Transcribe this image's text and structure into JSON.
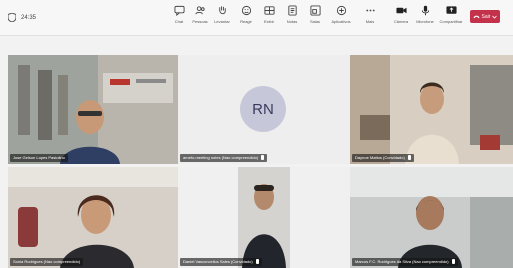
{
  "meeting": {
    "timer": "24:35"
  },
  "toolbar": {
    "buttons": [
      {
        "label": "Chat",
        "icon": "chat-icon"
      },
      {
        "label": "Pessoas",
        "icon": "people-icon"
      },
      {
        "label": "Levantar",
        "icon": "raise-hand-icon"
      },
      {
        "label": "Reagir",
        "icon": "react-icon"
      },
      {
        "label": "Exibir",
        "icon": "view-icon"
      },
      {
        "label": "Notas",
        "icon": "notes-icon"
      },
      {
        "label": "Salas",
        "icon": "rooms-icon"
      },
      {
        "label": "Aplicativos",
        "icon": "apps-icon"
      },
      {
        "label": "Mais",
        "icon": "more-icon"
      },
      {
        "label": "Câmera",
        "icon": "camera-icon"
      },
      {
        "label": "Microfone",
        "icon": "microphone-icon"
      },
      {
        "label": "Compartilhar",
        "icon": "share-icon"
      }
    ],
    "leave_label": "Sair",
    "leave_color": "#c4314b"
  },
  "participants": [
    {
      "name": "Jose Gelson Lopes Pastolino",
      "tile": "top-left"
    },
    {
      "name": "arnefo.meeting notes (Nao compreendido)",
      "initials": "RN",
      "tile": "top-center"
    },
    {
      "name": "Daynoe Mattos (Convidado)",
      "tile": "top-right"
    },
    {
      "name": "Sonia Rodrigues (Nao compreendido)",
      "tile": "bottom-left"
    },
    {
      "name": "Daniel Vasconcellos Sales (Convidado)",
      "tile": "bottom-center"
    },
    {
      "name": "Marcos F.C. Rodrigues da Silva (Nao compreendido)",
      "tile": "bottom-right"
    }
  ]
}
